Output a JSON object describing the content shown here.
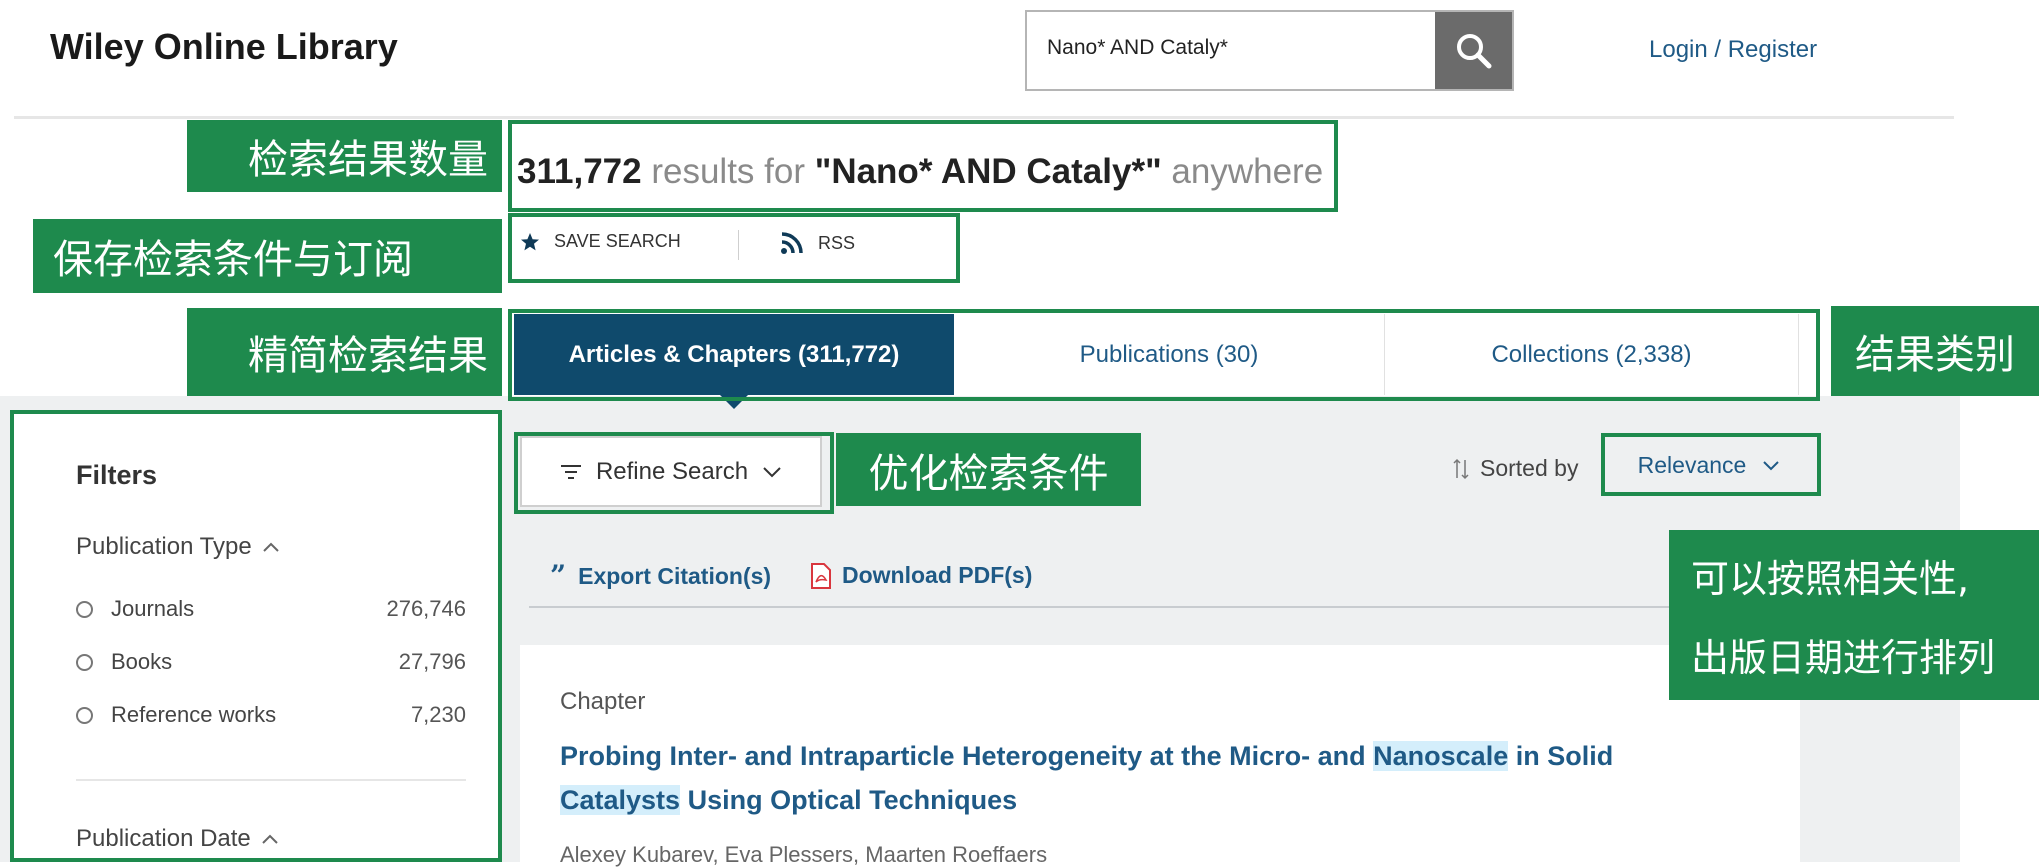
{
  "header": {
    "logo": "Wiley Online Library",
    "search": {
      "value": "Nano* AND Cataly*",
      "button_icon": "search-icon"
    },
    "login": "Login / Register"
  },
  "results": {
    "count": "311,772",
    "text_for": "results for",
    "query": "\"Nano* AND Cataly*\"",
    "scope": "anywhere"
  },
  "actions": {
    "save_search": "SAVE SEARCH",
    "rss": "RSS"
  },
  "tabs": [
    {
      "label": "Articles & Chapters (311,772)",
      "active": true
    },
    {
      "label": "Publications (30)",
      "active": false
    },
    {
      "label": "Collections (2,338)",
      "active": false
    }
  ],
  "filters": {
    "title": "Filters",
    "publication_type": {
      "label": "Publication Type",
      "options": [
        {
          "label": "Journals",
          "count": "276,746"
        },
        {
          "label": "Books",
          "count": "27,796"
        },
        {
          "label": "Reference works",
          "count": "7,230"
        }
      ]
    },
    "publication_date": {
      "label": "Publication Date"
    }
  },
  "toolbar": {
    "refine": "Refine Search",
    "sorted_by": "Sorted by",
    "sort_value": "Relevance",
    "export": "Export Citation(s)",
    "download": "Download PDF(s)"
  },
  "result": {
    "type": "Chapter",
    "title_parts": {
      "p1": "Probing Inter- and Intraparticle Heterogeneity at the Micro- and",
      "h1": "Nanoscale",
      "p2": "in Solid",
      "h2": "Catalysts",
      "p3": "Using Optical Techniques"
    },
    "authors": "Alexey Kubarev, Eva Plessers, Maarten Roeffaers"
  },
  "annotations": {
    "count": "检索结果数量",
    "save": "保存检索条件与订阅",
    "refine": "精简检索结果",
    "category": "结果类别",
    "optimize": "优化检索条件",
    "sort_line1": "可以按照相关性,",
    "sort_line2": "出版日期进行排列"
  },
  "colors": {
    "annotation": "#1e8a4d",
    "link": "#1f5a86",
    "active_tab": "#0f4a6c"
  }
}
